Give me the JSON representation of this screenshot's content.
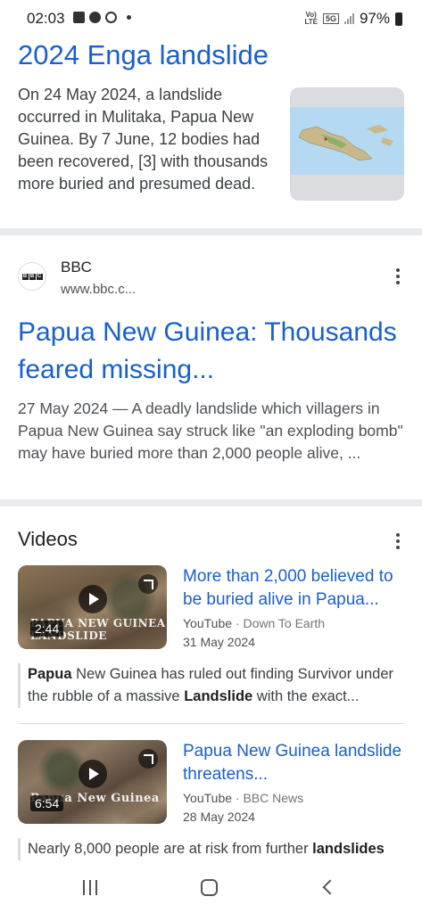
{
  "status_bar": {
    "time": "02:03",
    "network_label_top": "Vo)",
    "network_label_bottom": "LTE",
    "network_type": "5G",
    "battery": "97%"
  },
  "knowledge_panel": {
    "title": "2024 Enga landslide",
    "description": "On 24 May 2024, a landslide occurred in Mulitaka, Papua New Guinea. By 7 June, 12 bodies had been recovered, [3] with thousands more buried and presumed dead.",
    "map_icon": "map-thumbnail"
  },
  "search_result": {
    "source_name": "BBC",
    "source_url": "www.bbc.c...",
    "logo_letters": [
      "B",
      "B",
      "C"
    ],
    "title": "Papua New Guinea: Thousands feared missing...",
    "snippet": "27 May 2024 — A deadly landslide which villagers in Papua New Guinea say struck like \"an exploding bomb\" may have buried more than 2,000 people alive, ..."
  },
  "videos": {
    "heading": "Videos",
    "items": [
      {
        "title": "More than 2,000 believed to be buried alive in Papua...",
        "platform": "YouTube",
        "channel": "Down To Earth",
        "date": "31 May 2024",
        "duration": "2:44",
        "overlay_text": "PAPUA NEW GUINEA LANDSLIDE",
        "snippet_html_parts": [
          "Papua",
          " New Guinea has ruled out finding Survivor under the rubble of a massive ",
          "Landslide",
          " with the exact..."
        ]
      },
      {
        "title": "Papua New Guinea landslide threatens...",
        "platform": "YouTube",
        "channel": "BBC News",
        "date": "28 May 2024",
        "duration": "6:54",
        "overlay_text": "Papua New Guinea",
        "snippet_html_parts": [
          "Nearly 8,000 people are at risk from further ",
          "landslides",
          ""
        ]
      }
    ]
  },
  "colors": {
    "link_blue": "#1a5fcc",
    "divider": "#e8eaed"
  }
}
